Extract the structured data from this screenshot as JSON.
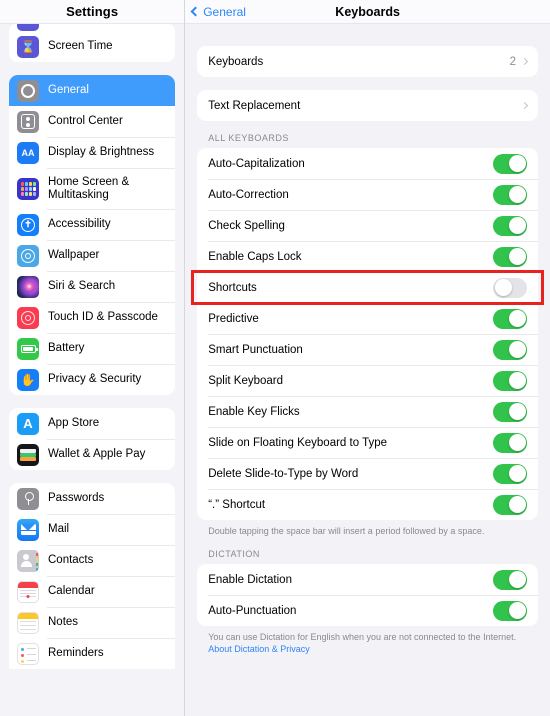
{
  "sidebar": {
    "title": "Settings",
    "groups": [
      {
        "id": "group-screentime",
        "clipped_top": true,
        "items": [
          {
            "label": "Screen Time",
            "icon": "hourglass-icon",
            "selected": false
          }
        ]
      },
      {
        "id": "group-system",
        "items": [
          {
            "label": "General",
            "icon": "gear-icon",
            "selected": true
          },
          {
            "label": "Control Center",
            "icon": "control-center-icon",
            "selected": false
          },
          {
            "label": "Display & Brightness",
            "icon": "display-brightness-icon",
            "selected": false
          },
          {
            "label": "Home Screen &\nMultitasking",
            "icon": "home-screen-icon",
            "selected": false,
            "two_line": true
          },
          {
            "label": "Accessibility",
            "icon": "accessibility-icon",
            "selected": false
          },
          {
            "label": "Wallpaper",
            "icon": "wallpaper-icon",
            "selected": false
          },
          {
            "label": "Siri & Search",
            "icon": "siri-icon",
            "selected": false
          },
          {
            "label": "Touch ID & Passcode",
            "icon": "touch-id-icon",
            "selected": false
          },
          {
            "label": "Battery",
            "icon": "battery-icon",
            "selected": false
          },
          {
            "label": "Privacy & Security",
            "icon": "privacy-hand-icon",
            "selected": false
          }
        ]
      },
      {
        "id": "group-store",
        "items": [
          {
            "label": "App Store",
            "icon": "app-store-icon",
            "selected": false
          },
          {
            "label": "Wallet & Apple Pay",
            "icon": "wallet-icon",
            "selected": false
          }
        ]
      },
      {
        "id": "group-apps",
        "clipped_bottom": true,
        "items": [
          {
            "label": "Passwords",
            "icon": "passwords-key-icon",
            "selected": false
          },
          {
            "label": "Mail",
            "icon": "mail-icon",
            "selected": false
          },
          {
            "label": "Contacts",
            "icon": "contacts-icon",
            "selected": false
          },
          {
            "label": "Calendar",
            "icon": "calendar-icon",
            "selected": false
          },
          {
            "label": "Notes",
            "icon": "notes-icon",
            "selected": false
          },
          {
            "label": "Reminders",
            "icon": "reminders-icon",
            "selected": false
          }
        ]
      }
    ]
  },
  "detail": {
    "back_label": "General",
    "title": "Keyboards",
    "nav_rows": [
      {
        "label": "Keyboards",
        "value": "2",
        "has_chevron": true
      },
      {
        "label": "Text Replacement",
        "value": "",
        "has_chevron": true
      }
    ],
    "all_keyboards": {
      "header": "ALL KEYBOARDS",
      "rows": [
        {
          "label": "Auto-Capitalization",
          "on": true,
          "highlighted": false
        },
        {
          "label": "Auto-Correction",
          "on": true,
          "highlighted": false
        },
        {
          "label": "Check Spelling",
          "on": true,
          "highlighted": false
        },
        {
          "label": "Enable Caps Lock",
          "on": true,
          "highlighted": false
        },
        {
          "label": "Shortcuts",
          "on": false,
          "highlighted": true
        },
        {
          "label": "Predictive",
          "on": true,
          "highlighted": false
        },
        {
          "label": "Smart Punctuation",
          "on": true,
          "highlighted": false
        },
        {
          "label": "Split Keyboard",
          "on": true,
          "highlighted": false
        },
        {
          "label": "Enable Key Flicks",
          "on": true,
          "highlighted": false
        },
        {
          "label": "Slide on Floating Keyboard to Type",
          "on": true,
          "highlighted": false
        },
        {
          "label": "Delete Slide-to-Type by Word",
          "on": true,
          "highlighted": false
        },
        {
          "label": "“.” Shortcut",
          "on": true,
          "highlighted": false
        }
      ],
      "footnote": "Double tapping the space bar will insert a period followed by a space."
    },
    "dictation": {
      "header": "DICTATION",
      "rows": [
        {
          "label": "Enable Dictation",
          "on": true
        },
        {
          "label": "Auto-Punctuation",
          "on": true
        }
      ],
      "footnote_text": "You can use Dictation for English when you are not connected to the Internet. ",
      "footnote_link": "About Dictation & Privacy"
    }
  },
  "annotation": {
    "target": "Shortcuts",
    "color": "#e8221c"
  },
  "colors": {
    "accent_blue": "#2f86f7",
    "selected_row": "#3f9bfc",
    "toggle_on": "#31c34b",
    "toggle_off": "#e4e4e8",
    "annotation_red": "#e8221c",
    "panel_bg": "#f2f2f7",
    "card_bg": "#ffffff"
  }
}
